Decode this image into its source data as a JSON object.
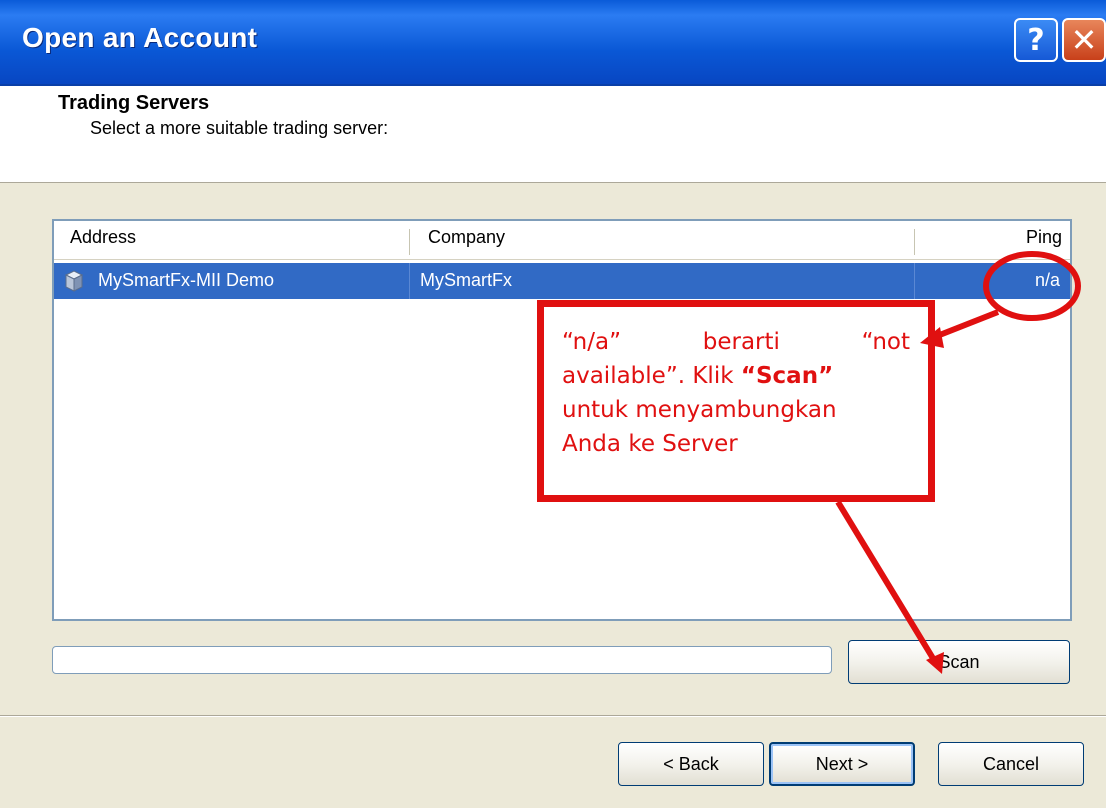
{
  "window": {
    "title": "Open an Account",
    "help_label": "?",
    "close_label": "✕"
  },
  "header": {
    "title": "Trading Servers",
    "subtitle": "Select a more suitable trading server:"
  },
  "list": {
    "columns": [
      "Address",
      "Company",
      "Ping"
    ],
    "rows": [
      {
        "address": "MySmartFx-MII Demo",
        "company": "MySmartFx",
        "ping": "n/a",
        "icon": "server-icon",
        "selected": true
      }
    ]
  },
  "annotation": {
    "line1_a": "“n/a”",
    "line1_b": "berarti",
    "line1_c": "“not",
    "line2_a": "available”. Klik ",
    "line2_bold": "“Scan”",
    "line3": "untuk menyambungkan",
    "line4": "Anda ke Server",
    "color": "#e01010"
  },
  "buttons": {
    "scan": "Scan",
    "back": "< Back",
    "next": "Next >",
    "cancel": "Cancel"
  },
  "colors": {
    "selection": "#316ac5",
    "titlebar": "#0a5bd8"
  }
}
